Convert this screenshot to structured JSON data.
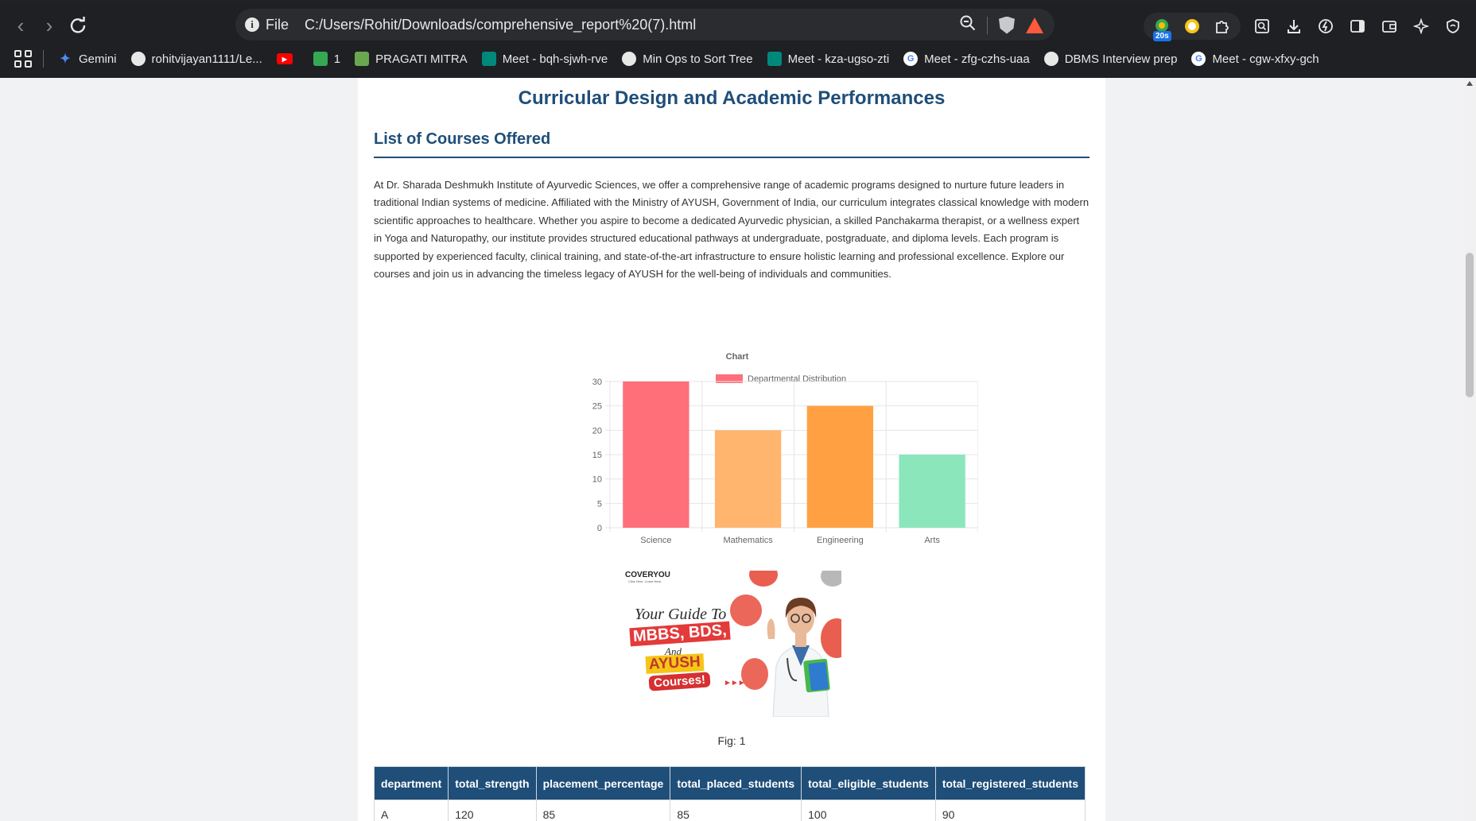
{
  "browser": {
    "omnibox": {
      "scheme_label": "File",
      "url": "C:/Users/Rohit/Downloads/comprehensive_report%20(7).html"
    },
    "extension_badge": "20s",
    "bookmarks": [
      {
        "label": "Gemini",
        "icon": "gemini-icon",
        "color": "#4a8cf7"
      },
      {
        "label": "rohitvijayan1111/Le...",
        "icon": "github-icon",
        "color": "#e8e8e8"
      },
      {
        "label": "",
        "icon": "youtube-icon",
        "color": "#ff0000"
      },
      {
        "label": "1",
        "icon": "sheet-icon",
        "color": "#34a853"
      },
      {
        "label": "PRAGATI MITRA",
        "icon": "pragati-icon",
        "color": "#6aa84f"
      },
      {
        "label": "Meet - bqh-sjwh-rve",
        "icon": "meet-icon",
        "color": "#00897b"
      },
      {
        "label": "Min Ops to Sort Tree",
        "icon": "openai-icon",
        "color": "#e8e8e8"
      },
      {
        "label": "Meet - kza-ugso-zti",
        "icon": "meet-icon",
        "color": "#00897b"
      },
      {
        "label": "Meet - zfg-czhs-uaa",
        "icon": "google-icon",
        "color": "#4285f4"
      },
      {
        "label": "DBMS Interview prep",
        "icon": "openai-icon",
        "color": "#e8e8e8"
      },
      {
        "label": "Meet - cgw-xfxy-gch",
        "icon": "google-icon",
        "color": "#4285f4"
      }
    ]
  },
  "page": {
    "title": "Curricular Design and Academic Performances",
    "section_title": "List of Courses Offered",
    "intro": "At Dr. Sharada Deshmukh Institute of Ayurvedic Sciences, we offer a comprehensive range of academic programs designed to nurture future leaders in traditional Indian systems of medicine. Affiliated with the Ministry of AYUSH, Government of India, our curriculum integrates classical knowledge with modern scientific approaches to healthcare. Whether you aspire to become a dedicated Ayurvedic physician, a skilled Panchakarma therapist, or a wellness expert in Yoga and Naturopathy, our institute provides structured educational pathways at undergraduate, postgraduate, and diploma levels. Each program is supported by experienced faculty, clinical training, and state-of-the-art infrastructure to ensure holistic learning and professional excellence. Explore our courses and join us in advancing the timeless legacy of AYUSH for the well-being of individuals and communities.",
    "promo": {
      "brand": "COVERYOU",
      "tagline": "Click Here. Come Here.",
      "line1": "Your Guide To",
      "line2": "MBBS, BDS,",
      "line3": "And",
      "line4": "AYUSH",
      "line5": "Courses!",
      "arrows": "►►►"
    },
    "figure_caption": "Fig: 1",
    "table": {
      "headers": [
        "department",
        "total_strength",
        "placement_percentage",
        "total_placed_students",
        "total_eligible_students",
        "total_registered_students"
      ],
      "rows": [
        [
          "A",
          "120",
          "85",
          "85",
          "100",
          "90"
        ]
      ]
    }
  },
  "chart_data": {
    "type": "bar",
    "title": "Chart",
    "categories": [
      "Science",
      "Mathematics",
      "Engineering",
      "Arts"
    ],
    "series": [
      {
        "name": "Departmental Distribution",
        "values": [
          30,
          20,
          25,
          15
        ]
      }
    ],
    "bar_colors": [
      "#ff6f7a",
      "#ffb56e",
      "#ffa142",
      "#8ce6bc"
    ],
    "legend_color": "#ff6f7a",
    "ylim": [
      0,
      30
    ],
    "yticks": [
      0,
      5,
      10,
      15,
      20,
      25,
      30
    ],
    "grid": true,
    "legend_position": "top"
  }
}
